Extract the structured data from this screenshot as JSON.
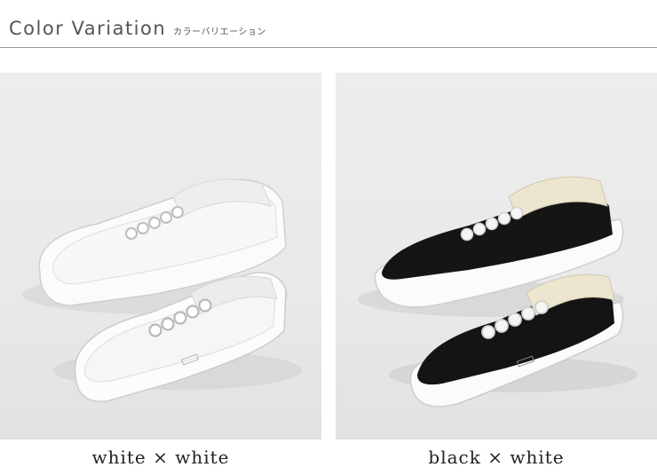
{
  "header": {
    "title": "Color Variation",
    "subtitle": "カラーバリエーション"
  },
  "variations": [
    {
      "caption": "white × white",
      "upper_color": "#f7f7f7",
      "sole_color": "#fbfbfb",
      "lining_color": "#f0f0f0"
    },
    {
      "caption": "black × white",
      "upper_color": "#161616",
      "sole_color": "#fbfbfb",
      "lining_color": "#ece5cf"
    }
  ],
  "colors": {
    "heading_text": "#555555",
    "caption_text": "#222222",
    "divider": "#9a9a9a",
    "panel_background": "#e9e9e9"
  }
}
